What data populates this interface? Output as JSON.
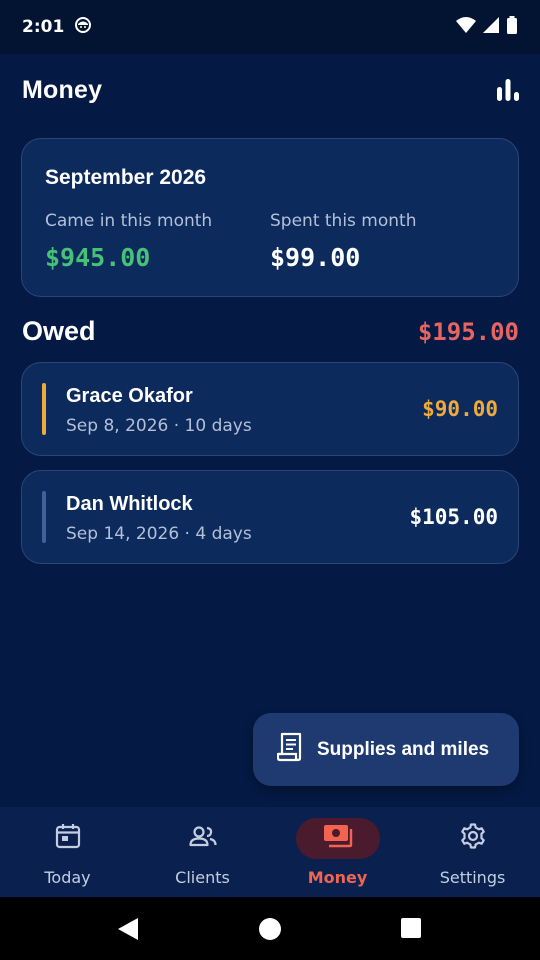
{
  "status_bar": {
    "time": "2:01",
    "icons": [
      "notification-icon",
      "wifi-icon",
      "signal-icon",
      "battery-icon"
    ]
  },
  "header": {
    "title": "Money",
    "action_icon": "bar-chart-icon"
  },
  "summary": {
    "month": "September 2026",
    "came_in_label": "Came in this month",
    "came_in_value": "$945.00",
    "spent_label": "Spent this month",
    "spent_value": "$99.00"
  },
  "owed": {
    "title": "Owed",
    "total": "$195.00",
    "items": [
      {
        "name": "Grace Okafor",
        "meta": "Sep 8, 2026 · 10 days",
        "amount": "$90.00",
        "accent": "#eeaa3c"
      },
      {
        "name": "Dan Whitlock",
        "meta": "Sep 14, 2026 · 4 days",
        "amount": "$105.00",
        "accent": "#44609a"
      }
    ]
  },
  "fab": {
    "label": "Supplies and miles",
    "icon": "receipt-icon"
  },
  "bottom_nav": {
    "items": [
      {
        "label": "Today",
        "icon": "calendar-icon",
        "active": false
      },
      {
        "label": "Clients",
        "icon": "people-icon",
        "active": false
      },
      {
        "label": "Money",
        "icon": "cash-icon",
        "active": true
      },
      {
        "label": "Settings",
        "icon": "gear-icon",
        "active": false
      }
    ]
  },
  "colors": {
    "background": "#041a44",
    "card": "#0d2a5c",
    "income": "#45c277",
    "owed_total": "#e76561",
    "active_nav": "#f2644f"
  }
}
